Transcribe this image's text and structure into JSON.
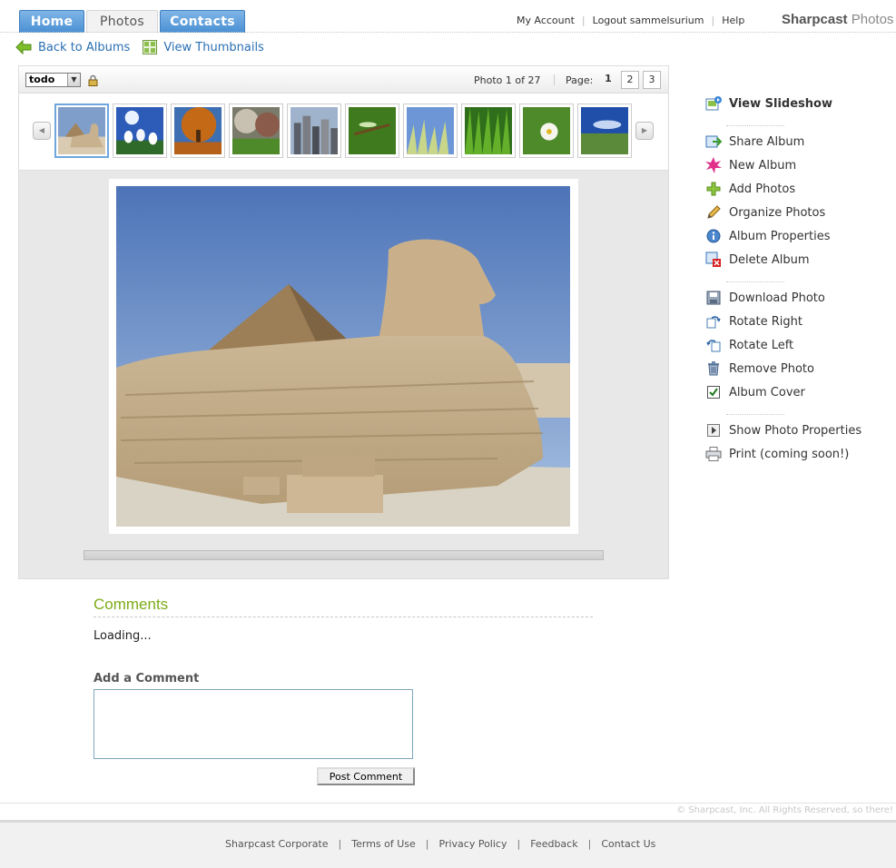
{
  "header": {
    "tabs": [
      {
        "label": "Home"
      },
      {
        "label": "Photos"
      },
      {
        "label": "Contacts"
      }
    ],
    "links": {
      "account": "My Account",
      "logout": "Logout sammelsurium",
      "help": "Help"
    },
    "logo": {
      "bold": "Sharpcast",
      "light": "Photos"
    }
  },
  "subnav": {
    "back": "Back to Albums",
    "thumbs": "View Thumbnails"
  },
  "toolbar": {
    "album_select": "todo",
    "photo_count": "Photo 1 of 27",
    "page_label": "Page:",
    "pages": [
      "1",
      "2",
      "3"
    ]
  },
  "sidebar": {
    "slideshow": "View Slideshow",
    "album_actions": [
      "Share Album",
      "New Album",
      "Add Photos",
      "Organize Photos",
      "Album Properties",
      "Delete Album"
    ],
    "photo_actions": [
      "Download Photo",
      "Rotate Right",
      "Rotate Left",
      "Remove Photo",
      "Album Cover"
    ],
    "other_actions": [
      "Show Photo Properties",
      "Print (coming soon!)"
    ]
  },
  "comments": {
    "title": "Comments",
    "status": "Loading...",
    "add_title": "Add a Comment",
    "post_label": "Post Comment"
  },
  "footer": {
    "copyright": "© Sharpcast, Inc. All Rights Reserved, so there!",
    "links": [
      "Sharpcast Corporate",
      "Terms of Use",
      "Privacy Policy",
      "Feedback",
      "Contact Us"
    ]
  },
  "colors": {
    "tab_blue": "#4a90d4",
    "link_blue": "#2a6fb2",
    "comments_green": "#7cac17"
  }
}
